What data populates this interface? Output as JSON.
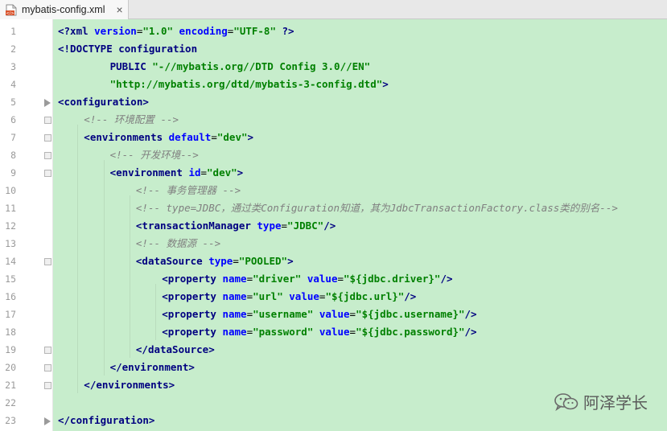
{
  "tab": {
    "filename": "mybatis-config.xml",
    "close_glyph": "×"
  },
  "lines": [
    {
      "n": "1",
      "indent": 0,
      "fold": "",
      "tokens": [
        {
          "t": "tag",
          "v": "<?xml "
        },
        {
          "t": "attr",
          "v": "version"
        },
        {
          "t": "plain",
          "v": "="
        },
        {
          "t": "str",
          "v": "\"1.0\""
        },
        {
          "t": "plain",
          "v": " "
        },
        {
          "t": "attr",
          "v": "encoding"
        },
        {
          "t": "plain",
          "v": "="
        },
        {
          "t": "str",
          "v": "\"UTF-8\""
        },
        {
          "t": "tag",
          "v": " ?>"
        }
      ]
    },
    {
      "n": "2",
      "indent": 0,
      "fold": "",
      "tokens": [
        {
          "t": "tag",
          "v": "<!DOCTYPE configuration"
        }
      ]
    },
    {
      "n": "3",
      "indent": 2,
      "fold": "",
      "tokens": [
        {
          "t": "tag",
          "v": "PUBLIC "
        },
        {
          "t": "doctext",
          "v": "\"-//mybatis.org//DTD Config 3.0//EN\""
        }
      ]
    },
    {
      "n": "4",
      "indent": 2,
      "fold": "",
      "tokens": [
        {
          "t": "doctext",
          "v": "\"http://mybatis.org/dtd/mybatis-3-config.dtd\""
        },
        {
          "t": "tag",
          "v": ">"
        }
      ]
    },
    {
      "n": "5",
      "indent": 0,
      "fold": "arrow",
      "tokens": [
        {
          "t": "tag",
          "v": "<configuration>"
        }
      ]
    },
    {
      "n": "6",
      "indent": 1,
      "fold": "start",
      "tokens": [
        {
          "t": "comment",
          "v": "<!-- 环境配置 -->"
        }
      ]
    },
    {
      "n": "7",
      "indent": 1,
      "fold": "start",
      "tokens": [
        {
          "t": "tag",
          "v": "<environments "
        },
        {
          "t": "attr",
          "v": "default"
        },
        {
          "t": "plain",
          "v": "="
        },
        {
          "t": "str",
          "v": "\"dev\""
        },
        {
          "t": "tag",
          "v": ">"
        }
      ]
    },
    {
      "n": "8",
      "indent": 2,
      "fold": "start",
      "tokens": [
        {
          "t": "comment",
          "v": "<!-- 开发环境-->"
        }
      ]
    },
    {
      "n": "9",
      "indent": 2,
      "fold": "start",
      "tokens": [
        {
          "t": "tag",
          "v": "<environment "
        },
        {
          "t": "attr",
          "v": "id"
        },
        {
          "t": "plain",
          "v": "="
        },
        {
          "t": "str",
          "v": "\"dev\""
        },
        {
          "t": "tag",
          "v": ">"
        }
      ]
    },
    {
      "n": "10",
      "indent": 3,
      "fold": "",
      "tokens": [
        {
          "t": "comment",
          "v": "<!-- 事务管理器 -->"
        }
      ]
    },
    {
      "n": "11",
      "indent": 3,
      "fold": "",
      "tokens": [
        {
          "t": "comment",
          "v": "<!-- type=JDBC，通过类Configuration知道，其为JdbcTransactionFactory.class类的别名-->"
        }
      ]
    },
    {
      "n": "12",
      "indent": 3,
      "fold": "",
      "tokens": [
        {
          "t": "tag",
          "v": "<transactionManager "
        },
        {
          "t": "attr",
          "v": "type"
        },
        {
          "t": "plain",
          "v": "="
        },
        {
          "t": "str",
          "v": "\"JDBC\""
        },
        {
          "t": "tag",
          "v": "/>"
        }
      ]
    },
    {
      "n": "13",
      "indent": 3,
      "fold": "",
      "tokens": [
        {
          "t": "comment",
          "v": "<!-- 数据源 -->"
        }
      ]
    },
    {
      "n": "14",
      "indent": 3,
      "fold": "start",
      "tokens": [
        {
          "t": "tag",
          "v": "<dataSource "
        },
        {
          "t": "attr",
          "v": "type"
        },
        {
          "t": "plain",
          "v": "="
        },
        {
          "t": "str",
          "v": "\"POOLED\""
        },
        {
          "t": "tag",
          "v": ">"
        }
      ]
    },
    {
      "n": "15",
      "indent": 4,
      "fold": "",
      "tokens": [
        {
          "t": "tag",
          "v": "<property "
        },
        {
          "t": "attr",
          "v": "name"
        },
        {
          "t": "plain",
          "v": "="
        },
        {
          "t": "str",
          "v": "\"driver\""
        },
        {
          "t": "plain",
          "v": " "
        },
        {
          "t": "attr",
          "v": "value"
        },
        {
          "t": "plain",
          "v": "="
        },
        {
          "t": "str",
          "v": "\"${jdbc.driver}\""
        },
        {
          "t": "tag",
          "v": "/>"
        }
      ]
    },
    {
      "n": "16",
      "indent": 4,
      "fold": "",
      "tokens": [
        {
          "t": "tag",
          "v": "<property "
        },
        {
          "t": "attr",
          "v": "name"
        },
        {
          "t": "plain",
          "v": "="
        },
        {
          "t": "str",
          "v": "\"url\""
        },
        {
          "t": "plain",
          "v": " "
        },
        {
          "t": "attr",
          "v": "value"
        },
        {
          "t": "plain",
          "v": "="
        },
        {
          "t": "str",
          "v": "\"${jdbc.url}\""
        },
        {
          "t": "tag",
          "v": "/>"
        }
      ]
    },
    {
      "n": "17",
      "indent": 4,
      "fold": "",
      "tokens": [
        {
          "t": "tag",
          "v": "<property "
        },
        {
          "t": "attr",
          "v": "name"
        },
        {
          "t": "plain",
          "v": "="
        },
        {
          "t": "str",
          "v": "\"username\""
        },
        {
          "t": "plain",
          "v": " "
        },
        {
          "t": "attr",
          "v": "value"
        },
        {
          "t": "plain",
          "v": "="
        },
        {
          "t": "str",
          "v": "\"${jdbc.username}\""
        },
        {
          "t": "tag",
          "v": "/>"
        }
      ]
    },
    {
      "n": "18",
      "indent": 4,
      "fold": "",
      "tokens": [
        {
          "t": "tag",
          "v": "<property "
        },
        {
          "t": "attr",
          "v": "name"
        },
        {
          "t": "plain",
          "v": "="
        },
        {
          "t": "str",
          "v": "\"password\""
        },
        {
          "t": "plain",
          "v": " "
        },
        {
          "t": "attr",
          "v": "value"
        },
        {
          "t": "plain",
          "v": "="
        },
        {
          "t": "str",
          "v": "\"${jdbc.password}\""
        },
        {
          "t": "tag",
          "v": "/>"
        }
      ]
    },
    {
      "n": "19",
      "indent": 3,
      "fold": "start",
      "tokens": [
        {
          "t": "tag",
          "v": "</dataSource>"
        }
      ]
    },
    {
      "n": "20",
      "indent": 2,
      "fold": "start",
      "tokens": [
        {
          "t": "tag",
          "v": "</environment>"
        }
      ]
    },
    {
      "n": "21",
      "indent": 1,
      "fold": "start",
      "tokens": [
        {
          "t": "tag",
          "v": "</environments>"
        }
      ]
    },
    {
      "n": "22",
      "indent": 0,
      "fold": "",
      "tokens": []
    },
    {
      "n": "23",
      "indent": 0,
      "fold": "arrow",
      "tokens": [
        {
          "t": "tag",
          "v": "</configuration>"
        }
      ]
    }
  ],
  "watermark": {
    "text": "阿泽学长",
    "icon": "wechat-icon"
  },
  "colors": {
    "editor_bg": "#c7edcc",
    "tag": "#000080",
    "attr": "#0000ff",
    "string": "#008000",
    "comment": "#808080"
  }
}
